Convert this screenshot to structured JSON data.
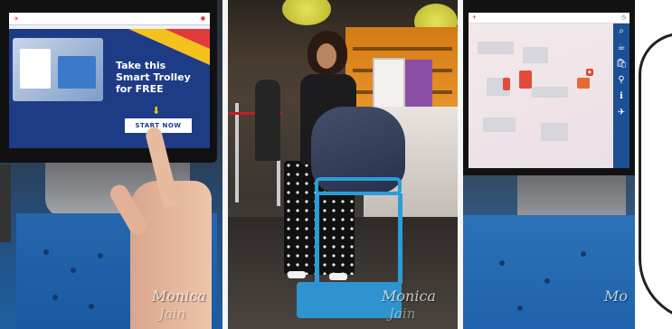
{
  "kiosk_left": {
    "headline": [
      "Take this",
      "Smart Trolley",
      "for FREE"
    ],
    "start_button": "START NOW"
  },
  "watermark": {
    "line1": "Monica",
    "line2": "Jain",
    "line1_clipped": "Mo"
  },
  "colors": {
    "kiosk_banner": "#1e3c86",
    "accent_yellow": "#f4c21c",
    "accent_red": "#e23b3b",
    "trolley_blue": "#2a9dd9"
  }
}
